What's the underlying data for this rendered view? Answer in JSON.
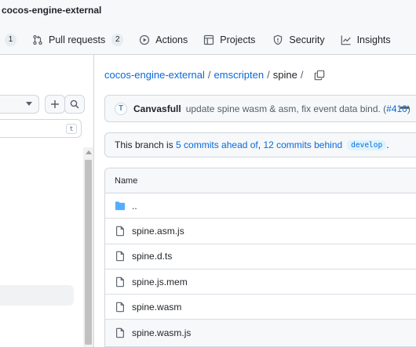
{
  "repo": {
    "title": "cocos-engine-external"
  },
  "nav": {
    "issues_count": "1",
    "pull_requests": {
      "label": "Pull requests",
      "count": "2"
    },
    "actions": "Actions",
    "projects": "Projects",
    "security": "Security",
    "insights": "Insights"
  },
  "sidebar": {
    "goto_file_key": "t",
    "icons": {
      "add": "plus-icon",
      "search": "search-icon"
    }
  },
  "breadcrumb": {
    "root": "cocos-engine-external",
    "sep1": "/",
    "folder": "emscripten",
    "sep2": "/",
    "current": "spine",
    "sep3": "/"
  },
  "commit": {
    "avatar_initial": "T",
    "author": "Canvasfull",
    "message": "update spine wasm & asm, fix event data bind. (",
    "pr": "#410",
    "message_end": ")"
  },
  "branch_status": {
    "prefix": "This branch is",
    "ahead": "5 commits ahead of",
    "comma": ",",
    "behind": "12 commits behind",
    "branch": "develop",
    "suffix": "."
  },
  "file_table": {
    "header": "Name",
    "rows": [
      {
        "name": "..",
        "icon": "folder-icon"
      },
      {
        "name": "spine.asm.js",
        "icon": "file-icon"
      },
      {
        "name": "spine.d.ts",
        "icon": "file-icon"
      },
      {
        "name": "spine.js.mem",
        "icon": "file-icon"
      },
      {
        "name": "spine.wasm",
        "icon": "file-icon"
      },
      {
        "name": "spine.wasm.js",
        "icon": "file-icon"
      }
    ]
  },
  "colors": {
    "link": "#0969da",
    "border": "#d0d7de",
    "muted": "#57606a",
    "folder": "#54aeff"
  }
}
